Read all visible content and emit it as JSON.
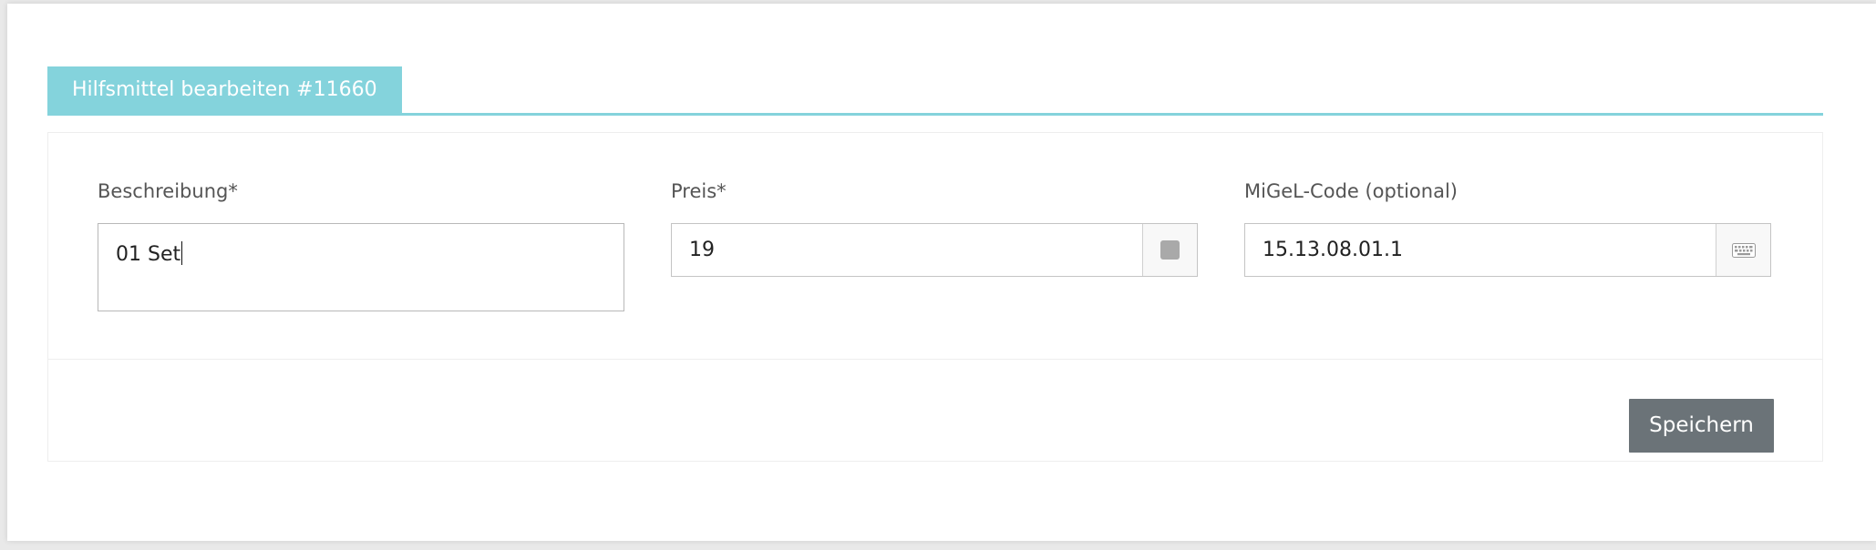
{
  "panel": {
    "title": "Hilfsmittel bearbeiten #11660",
    "accent_color": "#84d3dc"
  },
  "form": {
    "description": {
      "label": "Beschreibung*",
      "value": "01 Set"
    },
    "price": {
      "label": "Preis*",
      "value": "19",
      "addon_icon": "square-icon"
    },
    "migel": {
      "label": "MiGeL-Code (optional)",
      "value": "15.13.08.01.1",
      "addon_icon": "keyboard-icon"
    }
  },
  "actions": {
    "save_label": "Speichern",
    "save_color": "#6b7378"
  }
}
